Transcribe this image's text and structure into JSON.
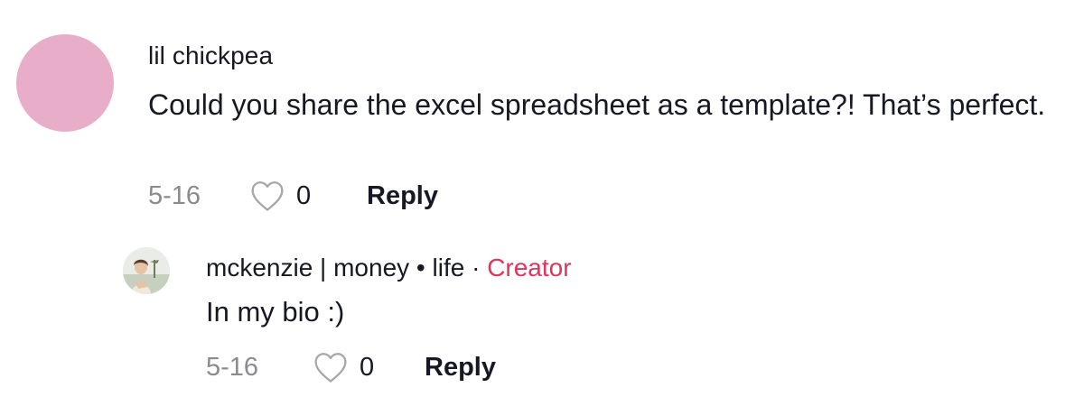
{
  "colors": {
    "background": "#ffffff",
    "text_primary": "#161823",
    "text_secondary": "#8a8b91",
    "creator_badge": "#e0345a",
    "avatar_placeholder": "#e8adc9"
  },
  "comment": {
    "avatar_icon": "user-avatar-pink-circle",
    "username": "lil chickpea",
    "text": "Could you share the excel spreadsheet as a template?! That’s perfect.",
    "date": "5-16",
    "like_icon": "heart-outline-icon",
    "like_count": "0",
    "reply_label": "Reply"
  },
  "reply": {
    "avatar_icon": "creator-avatar-photo",
    "username": "mckenzie | money • life",
    "separator": " · ",
    "badge": "Creator",
    "text": "In my bio :)",
    "date": "5-16",
    "like_icon": "heart-outline-icon",
    "like_count": "0",
    "reply_label": "Reply"
  }
}
